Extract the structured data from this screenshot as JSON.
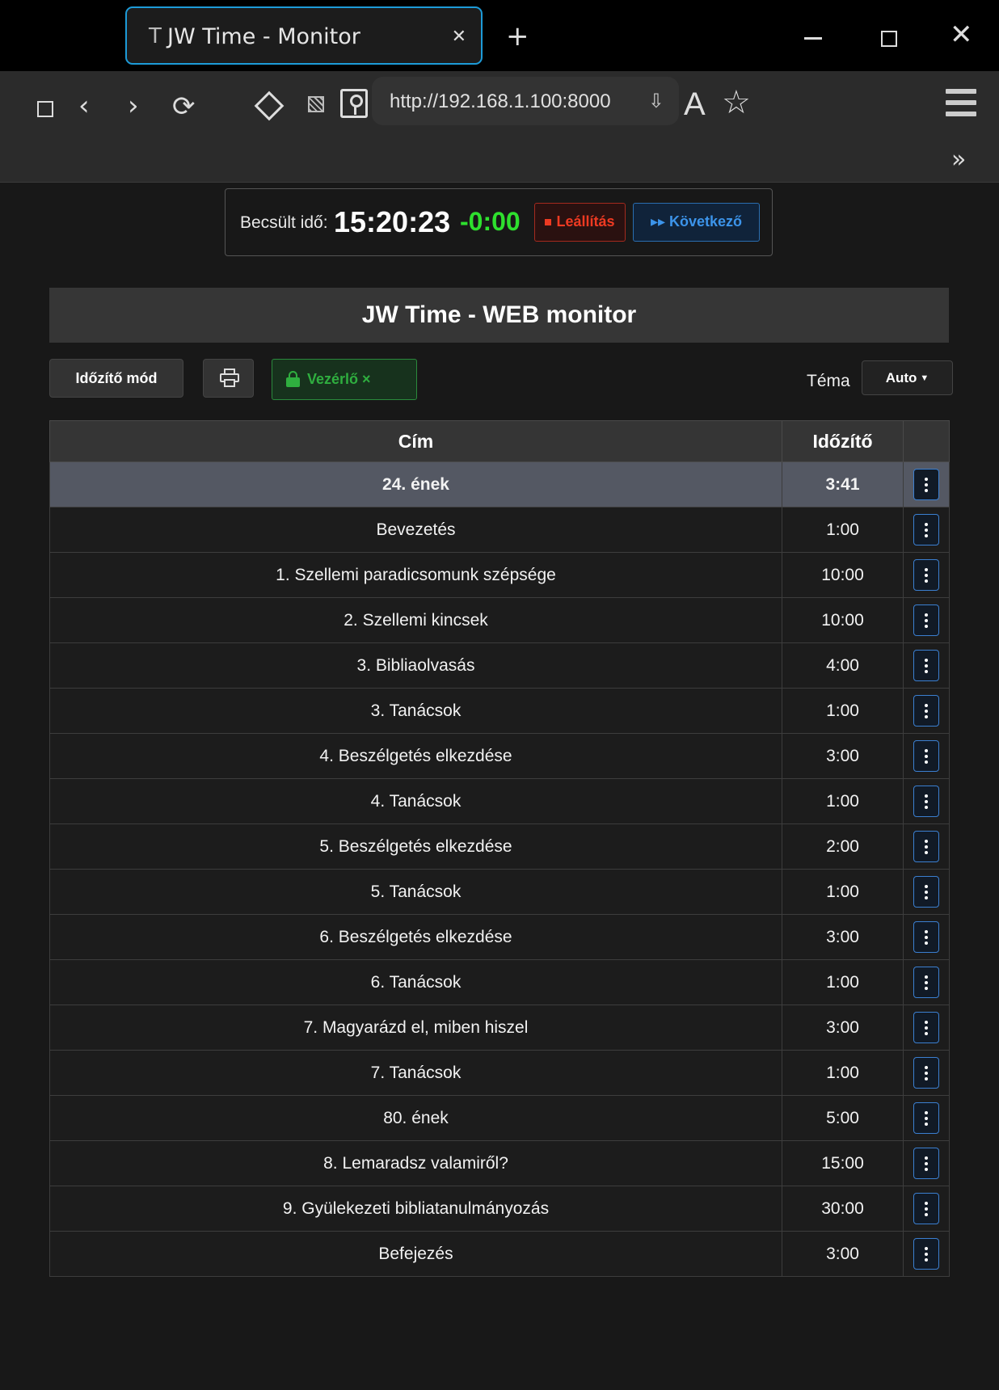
{
  "browser": {
    "tab_icon": "T",
    "tab_title": "JW Time - Monitor",
    "url": "http://192.168.1.100:8000"
  },
  "status": {
    "label": "Becsült idő:",
    "time": "15:20:23",
    "delta": "-0:00",
    "stop_label": "Leállítás",
    "next_label": "▸▸ Következő"
  },
  "header": {
    "title": "JW Time - WEB monitor"
  },
  "controls": {
    "mode_label": "Időzítő mód",
    "controller_label": "Vezérlő ×",
    "theme_label": "Téma",
    "theme_value": "Auto"
  },
  "table": {
    "columns": [
      "Cím",
      "Időzítő",
      ""
    ],
    "rows": [
      {
        "title": "24. ének",
        "timer": "3:41",
        "active": true
      },
      {
        "title": "Bevezetés",
        "timer": "1:00"
      },
      {
        "title": "1. Szellemi paradicsomunk szépsége",
        "timer": "10:00"
      },
      {
        "title": "2. Szellemi kincsek",
        "timer": "10:00"
      },
      {
        "title": "3. Bibliaolvasás",
        "timer": "4:00"
      },
      {
        "title": "3. Tanácsok",
        "timer": "1:00"
      },
      {
        "title": "4. Beszélgetés elkezdése",
        "timer": "3:00"
      },
      {
        "title": "4. Tanácsok",
        "timer": "1:00"
      },
      {
        "title": "5. Beszélgetés elkezdése",
        "timer": "2:00"
      },
      {
        "title": "5. Tanácsok",
        "timer": "1:00"
      },
      {
        "title": "6. Beszélgetés elkezdése",
        "timer": "3:00"
      },
      {
        "title": "6. Tanácsok",
        "timer": "1:00"
      },
      {
        "title": "7. Magyarázd el, miben hiszel",
        "timer": "3:00"
      },
      {
        "title": "7. Tanácsok",
        "timer": "1:00"
      },
      {
        "title": "80. ének",
        "timer": "5:00"
      },
      {
        "title": "8. Lemaradsz valamiről?",
        "timer": "15:00"
      },
      {
        "title": "9. Gyülekezeti bibliatanulmányozás",
        "timer": "30:00"
      },
      {
        "title": "Befejezés",
        "timer": "3:00"
      }
    ]
  },
  "colors": {
    "accent_blue": "#1d9bd8",
    "delta_green": "#2ee02e",
    "stop_red": "#ee3a22",
    "next_blue": "#3c94ea",
    "controller_green": "#2fae3f",
    "active_row": "#545863"
  },
  "icons": {
    "tab": "tab-letter-icon",
    "close_tab": "close-icon",
    "new_tab": "plus-icon",
    "window": [
      "minimize-icon",
      "maximize-icon",
      "close-icon"
    ],
    "toolbar": [
      "sidebar-icon",
      "back-icon",
      "forward-icon",
      "reload-icon",
      "diamond-icon",
      "hatched-icon",
      "key-icon",
      "download-icon",
      "reader-icon",
      "star-icon",
      "menu-icon",
      "more-icon"
    ],
    "page": [
      "stop-square-icon",
      "printer-icon",
      "lock-icon",
      "caret-down-icon",
      "kebab-icon"
    ]
  }
}
